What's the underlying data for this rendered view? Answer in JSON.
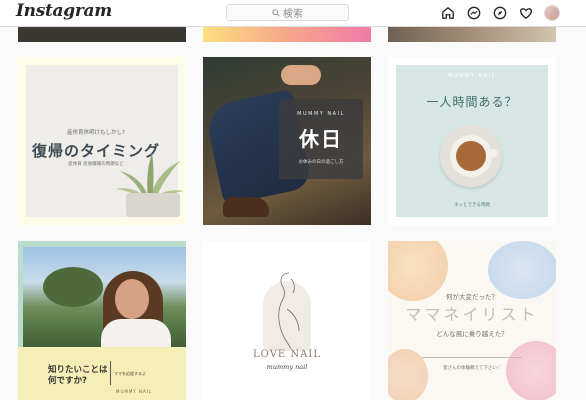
{
  "app": {
    "logo": "Instagram",
    "search_placeholder": "検索"
  },
  "nav": {
    "icons": [
      "home-icon",
      "messenger-icon",
      "explore-icon",
      "heart-icon",
      "avatar"
    ]
  },
  "grid": {
    "tile1": {
      "small_top": "産休育休明けもしかし?",
      "title": "復帰のタイミング",
      "small_bottom": "産休育 産後職場の時期など"
    },
    "tile2": {
      "brand": "MUMMY NAIL",
      "title": "休日",
      "subtitle": "お休みの日の過ごし方"
    },
    "tile3": {
      "brand": "MUMMY NAIL",
      "title": "一人時間ある？",
      "footer": "ホッとできる時間"
    },
    "tile4": {
      "question": "知りたいことは何ですか?",
      "ask": "ママを応援するよ",
      "brand": "MUMMY NAIL"
    },
    "tile5": {
      "title": "LOVE NAIL",
      "script": "mummy nail"
    },
    "tile6": {
      "question1": "何が大変だった？",
      "title": "ママネイリスト",
      "question2": "どんな風に乗り越えた？",
      "footer": "皆さんの体験教えて下さい♡"
    }
  }
}
